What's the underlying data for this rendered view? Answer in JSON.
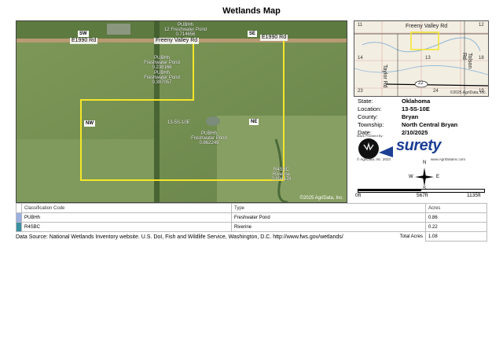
{
  "title": "Wetlands Map",
  "map": {
    "roads": [
      "E1990 Rd",
      "Freeny Valley Rd",
      "E1990 Rd"
    ],
    "corner_labels": [
      "SW",
      "SE",
      "NW",
      "NE"
    ],
    "section_label": "13-5S-10E",
    "copyright": "©2025 AgriData, Inc.",
    "wetlands": [
      {
        "code": "PUBHh",
        "type": "Freshwater Pond",
        "acres": "0.714656",
        "prefix": "12"
      },
      {
        "code": "PUBHh",
        "type": "Freshwater Pond",
        "acres": "0.238166"
      },
      {
        "code": "PUBHh",
        "type": "Freshwater Pond",
        "acres": "0.307057"
      },
      {
        "code": "PUBHh",
        "type": "Freshwater Pond",
        "acres": "0.862249"
      },
      {
        "code": "R4SBC",
        "type": "Riverine",
        "acres": "0.894178"
      }
    ],
    "boundary_color": "#f5e52a"
  },
  "inset": {
    "road": "Freeny Valley Rd",
    "road2": "Taylor Rd",
    "road3": "Tolson Rd",
    "highway": "22",
    "township_numbers": [
      "11",
      "12",
      "14",
      "13",
      "18",
      "23",
      "24",
      "19"
    ],
    "copyright": "©2025 AgriData, Inc."
  },
  "info": {
    "state_k": "State:",
    "state": "Oklahoma",
    "location_k": "Location:",
    "location": "13-5S-10E",
    "county_k": "County:",
    "county": "Bryan",
    "township_k": "Township:",
    "township": "North Central Bryan",
    "date_k": "Date:",
    "date": "2/10/2025"
  },
  "logo": {
    "maps_by": "Maps Provided By:",
    "brand": "surety",
    "left_note": "© AgriData, Inc. 2023",
    "right_note": "www.AgriDataInc.com"
  },
  "compass": {
    "n": "N",
    "s": "S",
    "e": "E",
    "w": "W"
  },
  "scale": {
    "labels": [
      "0ft",
      "567ft",
      "1135ft"
    ]
  },
  "legend": {
    "headers": [
      "Classification Code",
      "Type",
      "Acres"
    ],
    "rows": [
      {
        "code": "PUBHh",
        "type": "Freshwater Pond",
        "acres": "0.86",
        "color": "#9bb0e0"
      },
      {
        "code": "R4SBC",
        "type": "Riverine",
        "acres": "0.22",
        "color": "#3a8fa0"
      }
    ],
    "total_label": "Total Acres",
    "total": "1.08"
  },
  "source": "Data Source: National Wetlands Inventory website. U.S. DoI, Fish and Wildlife Service, Washington, D.C. http://www.fws.gov/wetlands/"
}
